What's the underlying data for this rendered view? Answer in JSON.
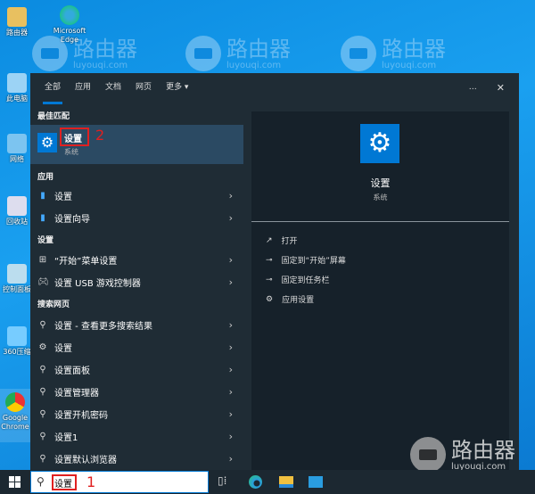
{
  "desktop": {
    "icons": [
      "路由器",
      "Microsoft Edge",
      "此电脑",
      "网络",
      "回收站",
      "控制面板",
      "360压缩",
      "Google Chrome"
    ],
    "watermark": {
      "title": "路由器",
      "url": "luyouqi.com"
    }
  },
  "search_panel": {
    "tabs": [
      "全部",
      "应用",
      "文档",
      "网页",
      "更多 ▾"
    ],
    "more_icon": "…",
    "close_icon": "✕",
    "best_match_header": "最佳匹配",
    "best_match": {
      "title": "设置",
      "subtitle": "系统"
    },
    "apps_header": "应用",
    "apps": [
      "设置",
      "设置向导"
    ],
    "settings_header": "设置",
    "settings": [
      "“开始”菜单设置",
      "设置 USB 游戏控制器"
    ],
    "web_header": "搜索网页",
    "web": [
      "设置 - 查看更多搜索结果",
      "设置",
      "设置面板",
      "设置管理器",
      "设置开机密码",
      "设置1",
      "设置默认浏览器"
    ],
    "preview": {
      "title": "设置",
      "subtitle": "系统",
      "actions": [
        "打开",
        "固定到“开始”屏幕",
        "固定到任务栏",
        "应用设置"
      ]
    }
  },
  "taskbar": {
    "search_value": "设置"
  },
  "annotations": {
    "step1": "1",
    "step2": "2"
  },
  "colors": {
    "accent": "#0078d4",
    "highlight": "#2b4a63",
    "annotation": "#e02020"
  }
}
